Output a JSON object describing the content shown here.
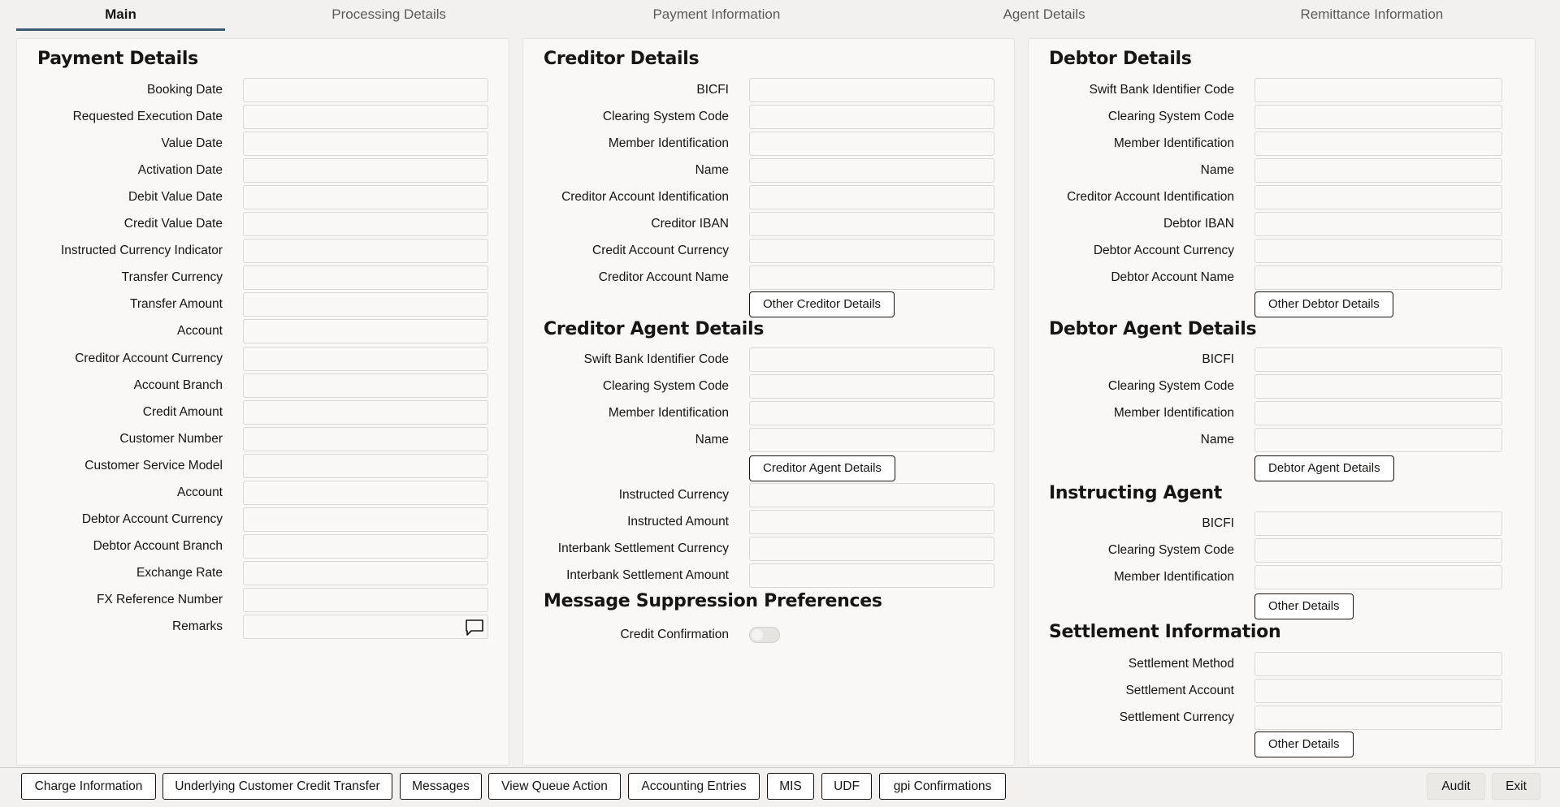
{
  "tabs": [
    "Main",
    "Processing Details",
    "Payment Information",
    "Agent Details",
    "Remittance Information"
  ],
  "payment_details": {
    "title": "Payment Details",
    "labels": [
      "Booking Date",
      "Requested Execution Date",
      "Value Date",
      "Activation Date",
      "Debit Value Date",
      "Credit Value Date",
      "Instructed Currency Indicator",
      "Transfer Currency",
      "Transfer Amount",
      "Account",
      "Creditor Account Currency",
      "Account Branch",
      "Credit Amount",
      "Customer Number",
      "Customer Service Model",
      "Account",
      "Debtor Account Currency",
      "Debtor Account Branch",
      "Exchange Rate",
      "FX Reference Number",
      "Remarks"
    ]
  },
  "creditor_details": {
    "title": "Creditor Details",
    "labels": [
      "BICFI",
      "Clearing System Code",
      "Member Identification",
      "Name",
      "Creditor Account Identification",
      "Creditor IBAN",
      "Credit Account Currency",
      "Creditor Account Name"
    ],
    "button": "Other Creditor Details"
  },
  "creditor_agent": {
    "title": "Creditor Agent Details",
    "labels": [
      "Swift Bank Identifier Code",
      "Clearing System Code",
      "Member Identification",
      "Name"
    ],
    "button": "Creditor Agent Details",
    "labels2": [
      "Instructed Currency",
      "Instructed Amount",
      "Interbank Settlement Currency",
      "Interbank Settlement Amount"
    ]
  },
  "message_suppression": {
    "title": "Message Suppression Preferences",
    "label": "Credit Confirmation",
    "value": false
  },
  "debtor_details": {
    "title": "Debtor Details",
    "labels": [
      "Swift Bank Identifier Code",
      "Clearing System Code",
      "Member Identification",
      "Name",
      "Creditor Account Identification",
      "Debtor IBAN",
      "Debtor Account Currency",
      "Debtor Account Name"
    ],
    "button": "Other Debtor Details"
  },
  "debtor_agent": {
    "title": "Debtor Agent Details",
    "labels": [
      "BICFI",
      "Clearing System Code",
      "Member Identification",
      "Name"
    ],
    "button": "Debtor Agent Details"
  },
  "instructing_agent": {
    "title": "Instructing Agent",
    "labels": [
      "BICFI",
      "Clearing System Code",
      "Member Identification"
    ],
    "button": "Other Details"
  },
  "settlement": {
    "title": "Settlement Information",
    "labels": [
      "Settlement Method",
      "Settlement Account",
      "Settlement Currency"
    ],
    "button": "Other Details"
  },
  "footer": {
    "left": [
      "Charge Information",
      "Underlying Customer Credit Transfer",
      "Messages",
      "View Queue Action",
      "Accounting Entries",
      "MIS",
      "UDF",
      "gpi Confirmations"
    ],
    "right": [
      "Audit",
      "Exit"
    ]
  }
}
